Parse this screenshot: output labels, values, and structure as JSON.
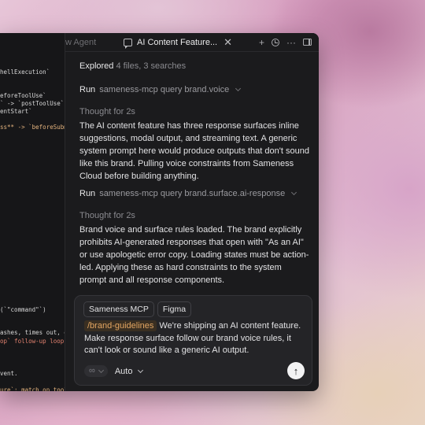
{
  "editor": {
    "lines": [
      {
        "text": "hellExecution`",
        "cls": "w"
      },
      {
        "text": "eforeToolUse`",
        "cls": "w"
      },
      {
        "text": "` -> `postToolUse`",
        "cls": "w"
      },
      {
        "text": "entStart`",
        "cls": "w"
      },
      {
        "text": "ss** -> `beforeSubmit",
        "cls": "o"
      },
      {
        "text": "(`\"command\"`)",
        "cls": "w"
      },
      {
        "text": "ashes, times out, or",
        "cls": "w"
      },
      {
        "text": "op` follow-up loops",
        "cls": "r"
      },
      {
        "text": "vent.",
        "cls": "w"
      },
      {
        "text": "ure`: match on tool",
        "cls": "o"
      }
    ]
  },
  "tabs": {
    "ghost_tab": "w Agent",
    "active_tab": "AI Content Feature...",
    "close": "✕",
    "add": "+",
    "more": "···"
  },
  "chat": {
    "explored_label": "Explored",
    "explored_detail": "4 files, 3 searches",
    "run1_label": "Run",
    "run1_cmd": "sameness-mcp query brand.voice",
    "thought1": "Thought for 2s",
    "para1": "The AI content feature has three response surfaces inline suggestions, modal output, and streaming text. A generic system prompt here would produce outputs that don't sound like this brand. Pulling voice constraints from Sameness Cloud before building anything.",
    "run2_label": "Run",
    "run2_cmd": "sameness-mcp query brand.surface.ai-response",
    "thought2": "Thought for 2s",
    "para2": "Brand voice and surface rules loaded. The brand explicitly prohibits AI-generated responses that open with \"As an AI\" or use apologetic error copy. Loading states must be action-led. Applying these as hard constraints to the system prompt and all response components."
  },
  "composer": {
    "chips": [
      "Sameness MCP",
      "Figma"
    ],
    "mention": "/brand-guidelines",
    "prompt_text": "We're shipping an AI content feature. Make response surface follow our brand voice rules, it can't look or sound like a generic AI output.",
    "mode_icon": "∞",
    "model": "Auto",
    "send_icon": "↑"
  }
}
